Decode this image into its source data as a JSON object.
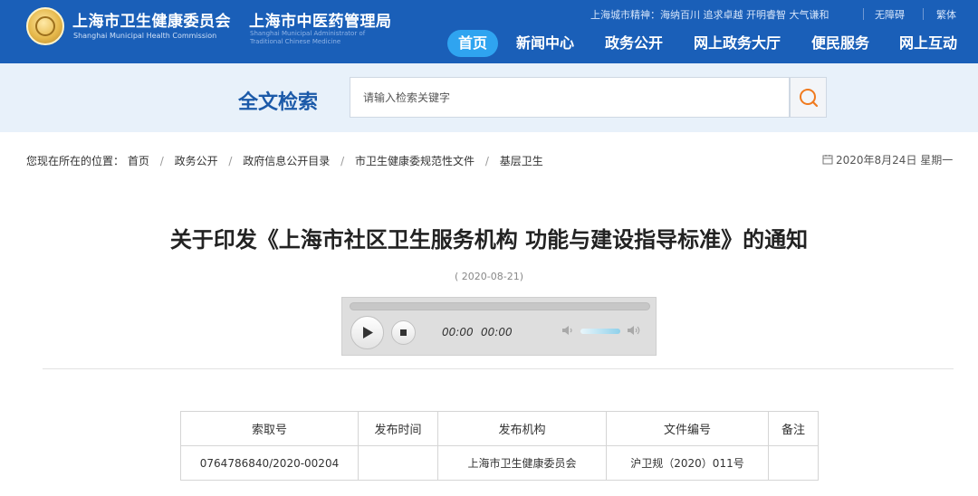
{
  "header": {
    "org1_cn": "上海市卫生健康委员会",
    "org1_en": "Shanghai Municipal Health Commission",
    "org2_cn": "上海市中医药管理局",
    "org2_en": "Shanghai Municipal Administrator of\nTraditional Chinese Medicine",
    "slogan": "上海城市精神：海纳百川 追求卓越 开明睿智 大气谦和",
    "accessibility": "无障碍",
    "traditional": "繁体",
    "nav": [
      "首页",
      "新闻中心",
      "政务公开",
      "网上政务大厅",
      "便民服务",
      "网上互动"
    ],
    "colors": {
      "header_bg": "#1a5fb8",
      "nav_active": "#2fa4f0"
    }
  },
  "search": {
    "title": "全文检索",
    "placeholder": "请输入检索关键字",
    "icon": "search-icon"
  },
  "breadcrumb": {
    "prefix": "您现在所在的位置：",
    "items": [
      "首页",
      "政务公开",
      "政府信息公开目录",
      "市卫生健康委规范性文件",
      "基层卫生"
    ]
  },
  "today": "2020年8月24日 星期一",
  "article": {
    "title": "关于印发《上海市社区卫生服务机构 功能与建设指导标准》的通知",
    "date": "( 2020-08-21)"
  },
  "player": {
    "current_time": "00:00",
    "duration": "00:00",
    "volume": 0.7
  },
  "info_table": {
    "headers": [
      "索取号",
      "发布时间",
      "发布机构",
      "文件编号",
      "备注"
    ],
    "row": [
      "0764786840/2020-00204",
      "",
      "上海市卫生健康委员会",
      "沪卫规（2020）011号",
      ""
    ]
  }
}
